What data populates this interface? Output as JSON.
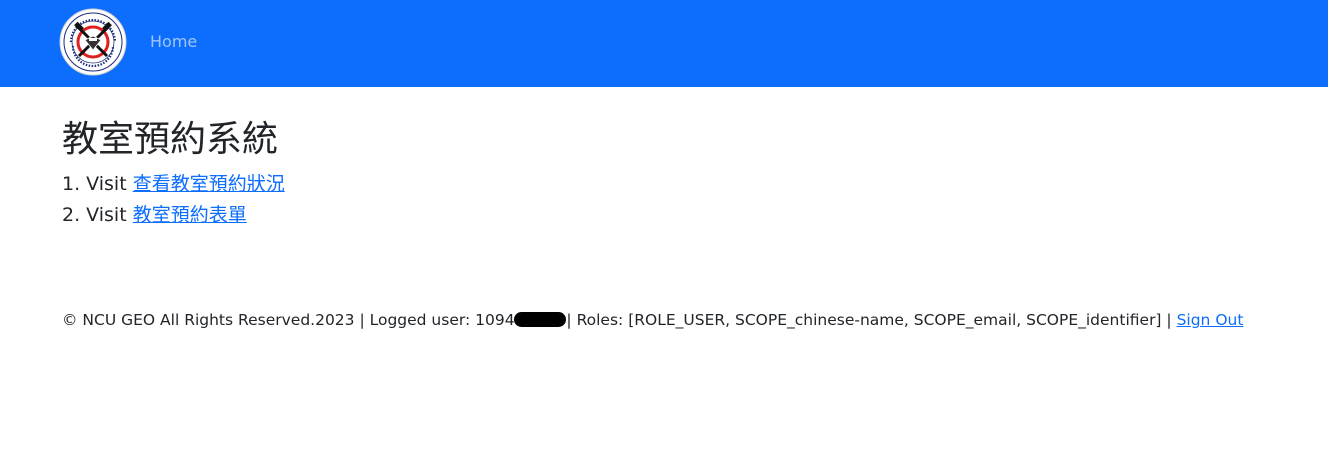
{
  "colors": {
    "navbar_bg": "#0d6efd",
    "link": "#0d6efd",
    "text": "#212529"
  },
  "navbar": {
    "logo_icon": "institute-seal-logo",
    "home_label": "Home"
  },
  "main": {
    "title": "教室預約系統",
    "items": [
      {
        "prefix": "1. Visit",
        "link_text": "查看教室預約狀況"
      },
      {
        "prefix": "2. Visit",
        "link_text": "教室預約表單"
      }
    ]
  },
  "footer": {
    "copyright": "© NCU GEO All Rights Reserved.2023 | Logged user: 10940",
    "roles": "| Roles: [ROLE_USER, SCOPE_chinese-name, SCOPE_email, SCOPE_identifier] |",
    "sign_out": "Sign Out"
  }
}
